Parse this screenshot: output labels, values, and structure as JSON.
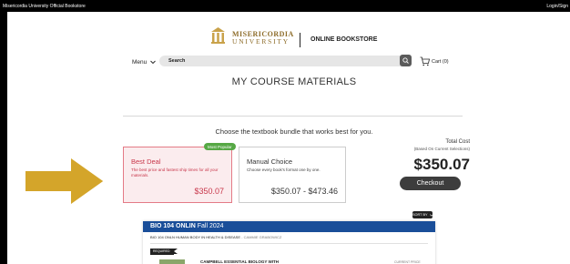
{
  "topbar": {
    "store_name": "Misericordia University Official Bookstore",
    "login_label": "Login/Sign"
  },
  "header": {
    "logo_line1": "MISERICORDIA",
    "logo_line2": "UNIVERSITY",
    "store_title": "ONLINE BOOKSTORE",
    "menu_label": "Menu",
    "search_placeholder": "Search",
    "cart_label": "Cart (0)"
  },
  "main": {
    "page_title": "MY COURSE MATERIALS",
    "subtitle": "Choose the textbook bundle that works best for you.",
    "options": [
      {
        "badge": "Most Popular",
        "title": "Best Deal",
        "description": "The best price and fastest ship times for all your materials.",
        "price": "$350.07"
      },
      {
        "title": "Manual Choice",
        "description": "Choose every book's format one by one.",
        "price": "$350.07 - $473.46"
      }
    ],
    "total": {
      "label": "Total Cost",
      "note": "(Based On Current Selections)",
      "amount": "$350.07",
      "checkout_label": "Checkout"
    },
    "sort_label": "SORT BY"
  },
  "course": {
    "code": "BIO 104 ONLIN",
    "term": "Fall 2024",
    "name": "BIO 104 ONLN HUMAN BODY IN HEALTH & DISEASE",
    "instructor": "- CAMMIE GRABOWICZ",
    "required_label": "REQUIRED",
    "book_title": "CAMPBELL ESSENTIAL BIOLOGY WITH",
    "current_price_label": "CURRENT PRICE"
  },
  "colors": {
    "accent_red": "#c8374b",
    "brand_gold": "#8e6d2a",
    "course_blue": "#1a4e99",
    "popular_green": "#56a845",
    "arrow_gold": "#d4a52a"
  }
}
